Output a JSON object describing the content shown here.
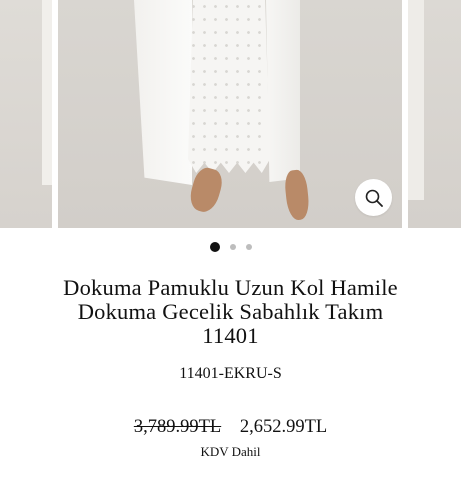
{
  "gallery": {
    "zoom_icon": "magnifier-icon",
    "slide_count": 3,
    "active_slide": 1
  },
  "product": {
    "title_line1": "Dokuma Pamuklu Uzun Kol Hamile",
    "title_line2": "Dokuma Gecelik Sabahlık Takım",
    "title_line3": "11401",
    "sku": "11401-EKRU-S",
    "old_price": "3,789.99TL",
    "price": "2,652.99TL",
    "tax_note": "KDV Dahil"
  }
}
